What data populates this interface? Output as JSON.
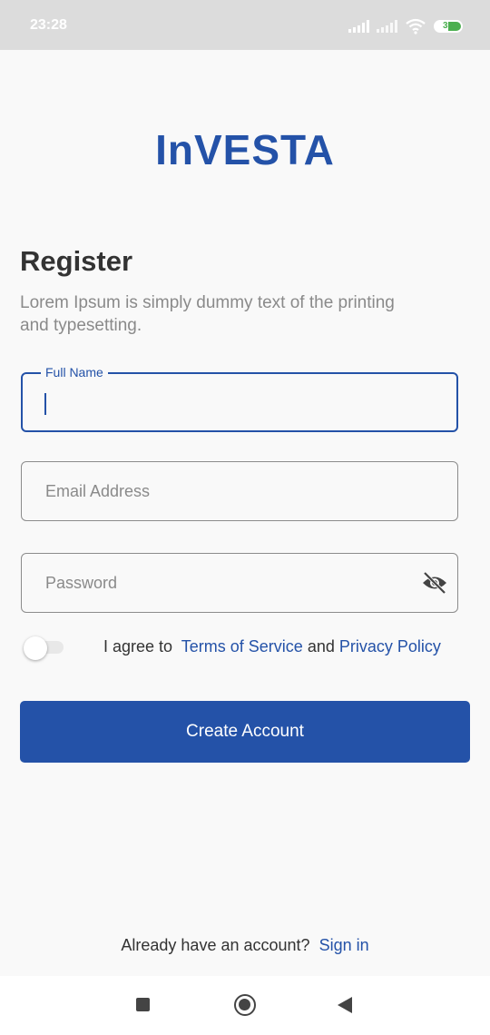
{
  "status_bar": {
    "time": "23:28",
    "battery_level": "39"
  },
  "app": {
    "logo": "InVESTA",
    "brand_color": "#2452a8"
  },
  "register": {
    "title": "Register",
    "subtitle": "Lorem Ipsum is simply dummy text of the printing and typesetting."
  },
  "form": {
    "full_name": {
      "label": "Full Name",
      "value": ""
    },
    "email": {
      "placeholder": "Email Address",
      "value": ""
    },
    "password": {
      "placeholder": "Password",
      "value": "",
      "visibility_icon": "eye-off-icon"
    }
  },
  "terms": {
    "toggle_on": false,
    "prefix": "I agree to",
    "terms_link": "Terms of Service",
    "and": "and",
    "privacy_link": "Privacy Policy"
  },
  "actions": {
    "create_account": "Create Account"
  },
  "footer": {
    "prompt": "Already have an account?",
    "signin_link": "Sign in"
  },
  "nav": {
    "recents_icon": "square-icon",
    "home_icon": "circle-icon",
    "back_icon": "triangle-back-icon"
  }
}
